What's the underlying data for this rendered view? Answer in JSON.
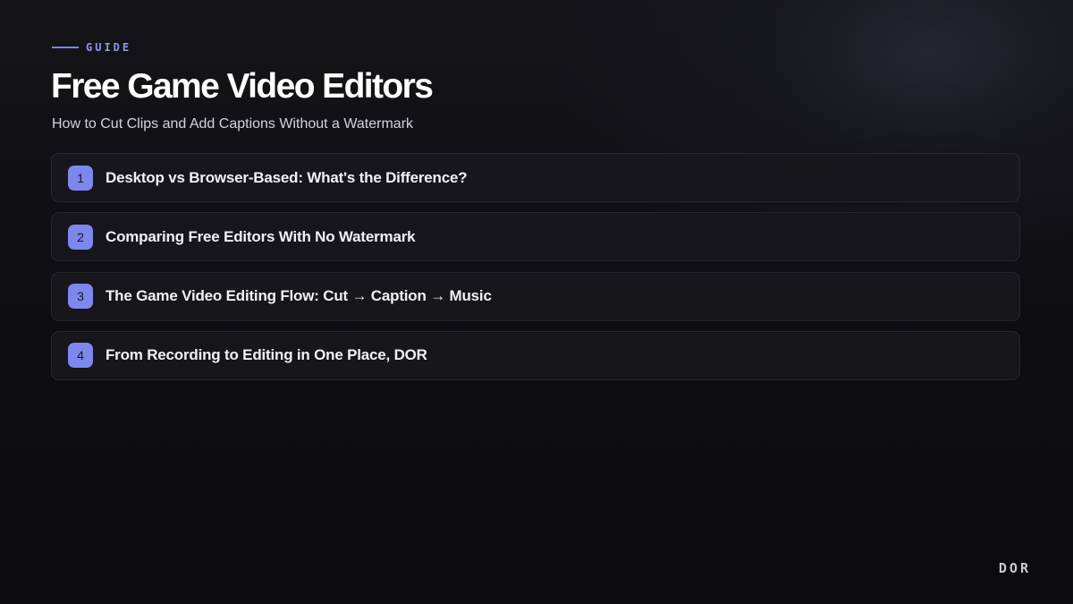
{
  "header": {
    "eyebrow": "GUIDE",
    "title": "Free Game Video Editors",
    "subtitle": "How to Cut Clips and Add Captions Without a Watermark"
  },
  "toc": {
    "items": [
      {
        "number": "1",
        "label": "Desktop vs Browser-Based: What's the Difference?"
      },
      {
        "number": "2",
        "label": "Comparing Free Editors With No Watermark"
      },
      {
        "number": "3",
        "label": "The Game Video Editing Flow: Cut → Caption → Music"
      },
      {
        "number": "4",
        "label": "From Recording to Editing in One Place, DOR"
      }
    ]
  },
  "footer": {
    "brand": "DOR"
  },
  "colors": {
    "accent": "#7e87ee",
    "background": "#0d0d10",
    "card_border": "#26262d"
  }
}
